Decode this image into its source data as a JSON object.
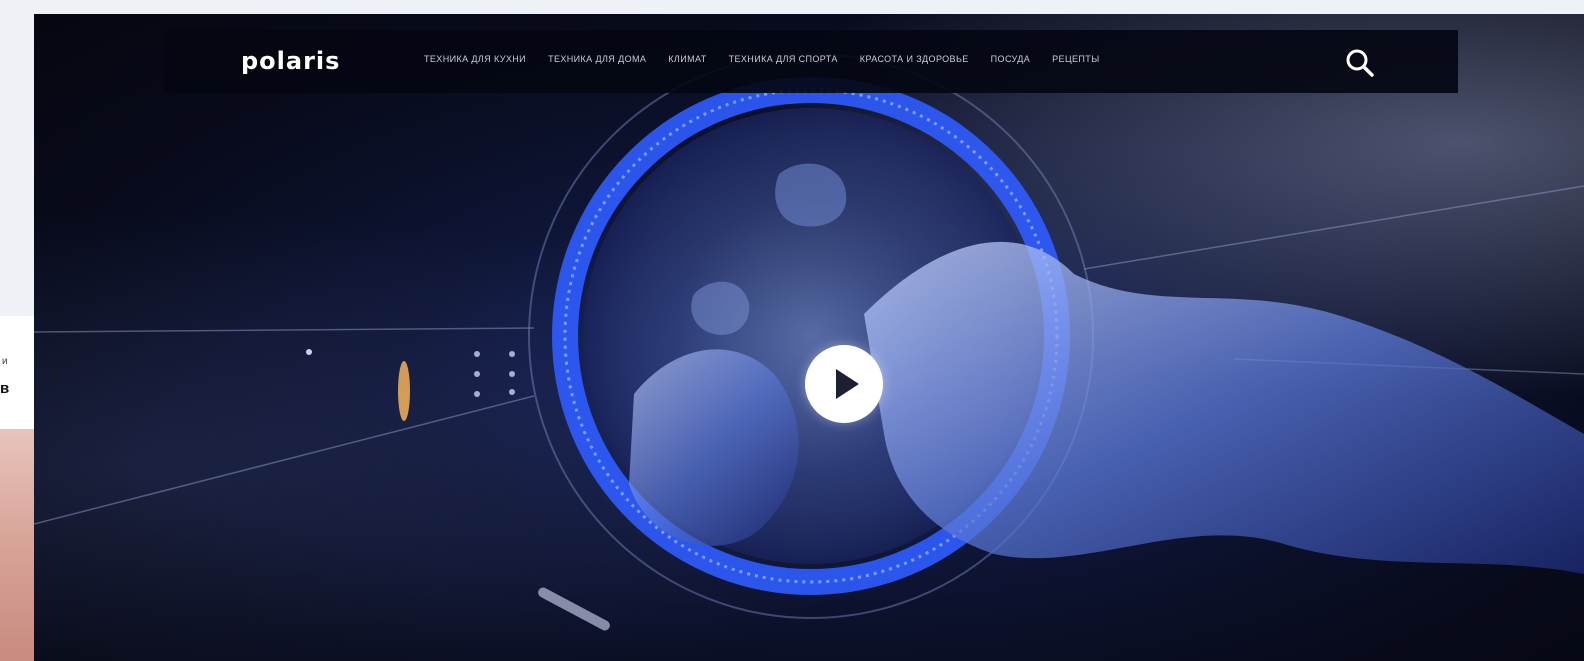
{
  "side_card": {
    "fragment_top": "и",
    "fragment_bottom": "в"
  },
  "header": {
    "logo": "polaris",
    "nav": [
      "ТЕХНИКА ДЛЯ КУХНИ",
      "ТЕХНИКА ДЛЯ ДОМА",
      "КЛИМАТ",
      "ТЕХНИКА ДЛЯ СПОРТА",
      "КРАСОТА И ЗДОРОВЬЕ",
      "ПОСУДА",
      "РЕЦЕПТЫ"
    ],
    "search_icon": "search-icon"
  },
  "hero": {
    "play_icon": "play-icon",
    "colors": {
      "ring": "#2f5cff",
      "background": "#080b1c",
      "navbar": "#04080f"
    }
  }
}
